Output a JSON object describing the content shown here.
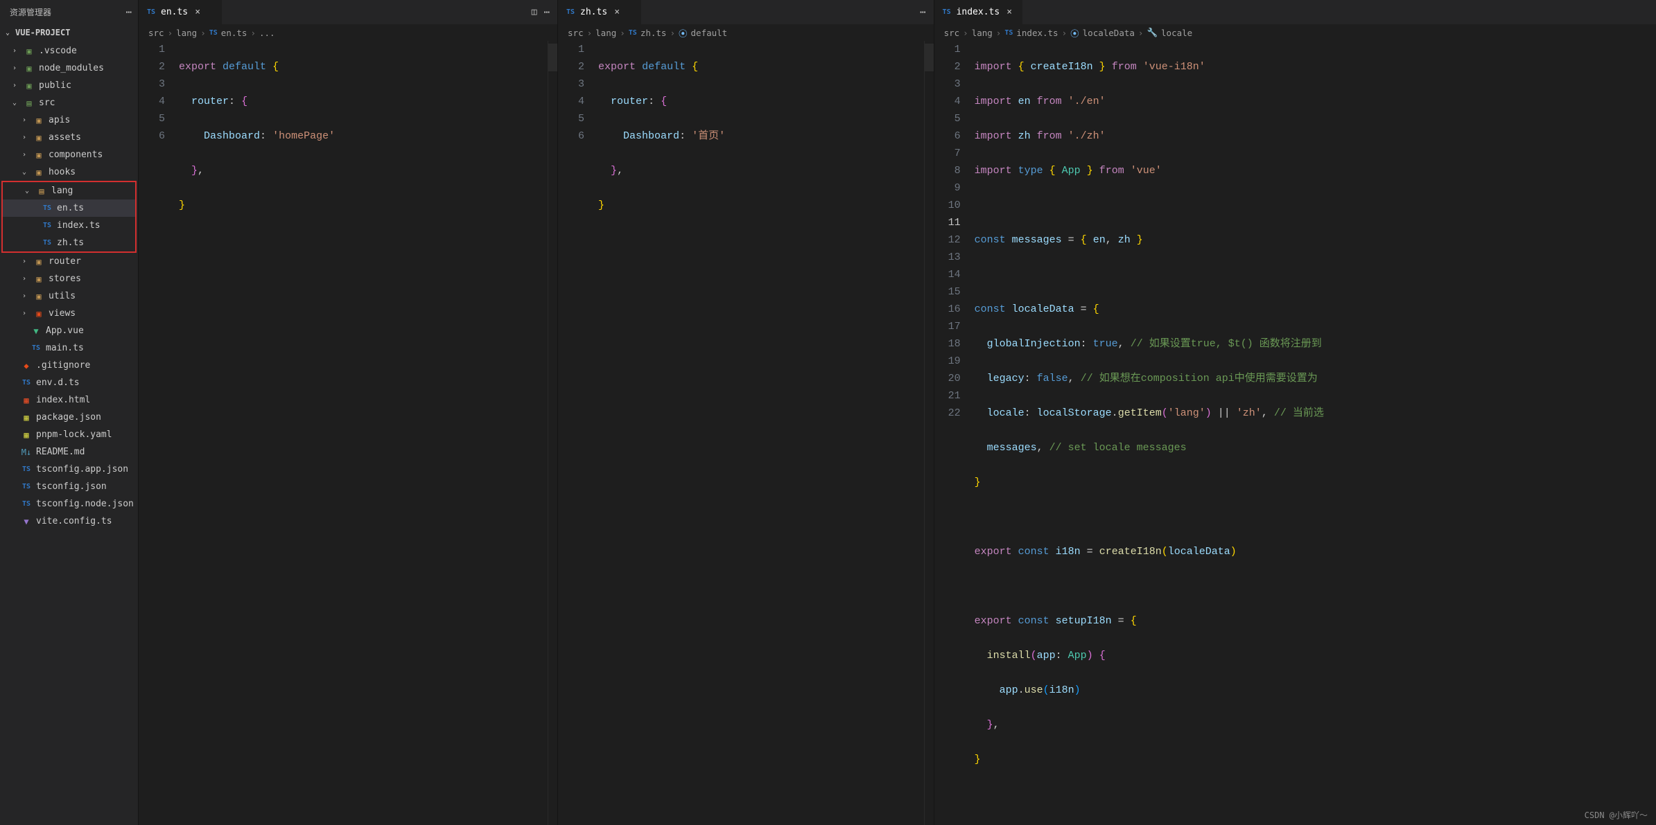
{
  "sidebar": {
    "title": "资源管理器",
    "project": "VUE-PROJECT",
    "items": {
      "vscode": ".vscode",
      "node_modules": "node_modules",
      "public": "public",
      "src": "src",
      "apis": "apis",
      "assets": "assets",
      "components": "components",
      "hooks": "hooks",
      "lang": "lang",
      "en": "en.ts",
      "index": "index.ts",
      "zh": "zh.ts",
      "router": "router",
      "stores": "stores",
      "utils": "utils",
      "views": "views",
      "app_vue": "App.vue",
      "main_ts": "main.ts",
      "gitignore": ".gitignore",
      "env": "env.d.ts",
      "index_html": "index.html",
      "package": "package.json",
      "pnpm": "pnpm-lock.yaml",
      "readme": "README.md",
      "tsconfig_app": "tsconfig.app.json",
      "tsconfig": "tsconfig.json",
      "tsconfig_node": "tsconfig.node.json",
      "vite": "vite.config.ts"
    }
  },
  "tabs": {
    "en": "en.ts",
    "zh": "zh.ts",
    "index": "index.ts"
  },
  "breadcrumbs": {
    "p1": {
      "a": "src",
      "b": "lang",
      "c": "en.ts",
      "d": "..."
    },
    "p2": {
      "a": "src",
      "b": "lang",
      "c": "zh.ts",
      "d": "default"
    },
    "p3": {
      "a": "src",
      "b": "lang",
      "c": "index.ts",
      "d": "localeData",
      "e": "locale"
    }
  },
  "code_en": {
    "l1_export": "export",
    "l1_default": "default",
    "l2_router": "router",
    "l3_dashboard": "Dashboard",
    "l3_val": "'homePage'"
  },
  "code_zh": {
    "l1_export": "export",
    "l1_default": "default",
    "l2_router": "router",
    "l3_dashboard": "Dashboard",
    "l3_val": "'首页'"
  },
  "code_index": {
    "l1": {
      "import": "import",
      "create": "createI18n",
      "from": "from",
      "pkg": "'vue-i18n'"
    },
    "l2": {
      "import": "import",
      "en": "en",
      "from": "from",
      "path": "'./en'"
    },
    "l3": {
      "import": "import",
      "zh": "zh",
      "from": "from",
      "path": "'./zh'"
    },
    "l4": {
      "import": "import",
      "type": "type",
      "app": "App",
      "from": "from",
      "pkg": "'vue'"
    },
    "l6": {
      "const": "const",
      "messages": "messages",
      "en": "en",
      "zh": "zh"
    },
    "l8": {
      "const": "const",
      "locale": "localeData"
    },
    "l9": {
      "k": "globalInjection",
      "v": "true",
      "c": "// 如果设置true, $t() 函数将注册到"
    },
    "l10": {
      "k": "legacy",
      "v": "false",
      "c": "// 如果想在composition api中使用需要设置为"
    },
    "l11": {
      "k": "locale",
      "ls": "localStorage",
      "get": "getItem",
      "arg": "'lang'",
      "zh": "'zh'",
      "c": "// 当前选"
    },
    "l12": {
      "k": "messages",
      "c": "// set locale messages"
    },
    "l15": {
      "export": "export",
      "const": "const",
      "i18n": "i18n",
      "create": "createI18n",
      "arg": "localeData"
    },
    "l17": {
      "export": "export",
      "const": "const",
      "setup": "setupI18n"
    },
    "l18": {
      "install": "install",
      "app": "app",
      "type": "App"
    },
    "l19": {
      "app": "app",
      "use": "use",
      "i18n": "i18n"
    }
  },
  "gutters": {
    "six": [
      "1",
      "2",
      "3",
      "4",
      "5",
      "6"
    ],
    "twentytwo": [
      "1",
      "2",
      "3",
      "4",
      "5",
      "6",
      "7",
      "8",
      "9",
      "10",
      "11",
      "12",
      "13",
      "14",
      "15",
      "16",
      "17",
      "18",
      "19",
      "20",
      "21",
      "22"
    ]
  },
  "watermark": "CSDN @小辉吖～"
}
